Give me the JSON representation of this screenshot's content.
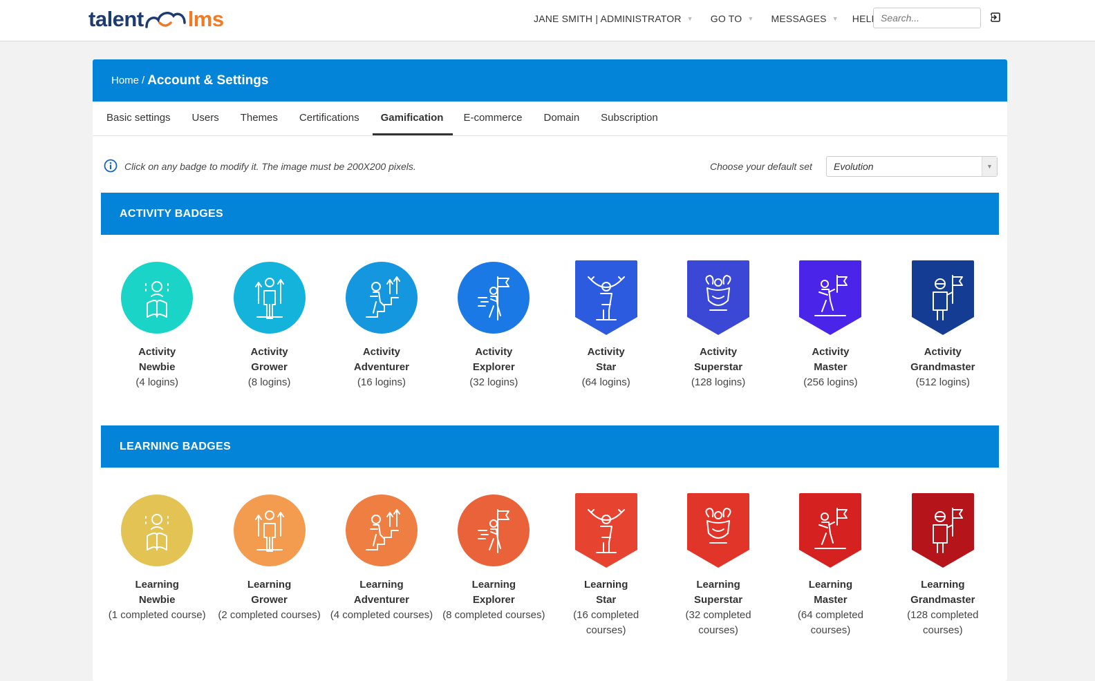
{
  "header": {
    "logo_left": "talent",
    "logo_right": "lms",
    "nav": [
      {
        "label": "JANE SMITH | ADMINISTRATOR"
      },
      {
        "label": "GO TO"
      },
      {
        "label": "MESSAGES"
      },
      {
        "label": "HELP"
      }
    ],
    "search_placeholder": "Search..."
  },
  "breadcrumb": {
    "home": "Home",
    "separator": "/",
    "title": "Account & Settings"
  },
  "tabs": [
    {
      "label": "Basic settings"
    },
    {
      "label": "Users"
    },
    {
      "label": "Themes"
    },
    {
      "label": "Certifications"
    },
    {
      "label": "Gamification",
      "active": true
    },
    {
      "label": "E-commerce"
    },
    {
      "label": "Domain"
    },
    {
      "label": "Subscription"
    }
  ],
  "info": {
    "message": "Click on any badge to modify it. The image must be 200X200 pixels.",
    "choose_label": "Choose your default set",
    "selected_set": "Evolution"
  },
  "activity": {
    "title": "ACTIVITY BADGES",
    "badges": [
      {
        "line1": "Activity",
        "line2": "Newbie",
        "desc": "(4 logins)",
        "color": "#1ad4c8",
        "shape": "circle",
        "icon": "reading-person-icon"
      },
      {
        "line1": "Activity",
        "line2": "Grower",
        "desc": "(8 logins)",
        "color": "#13b3dc",
        "shape": "circle",
        "icon": "growing-person-icon"
      },
      {
        "line1": "Activity",
        "line2": "Adventurer",
        "desc": "(16 logins)",
        "color": "#1597e0",
        "shape": "circle",
        "icon": "climbing-stairs-icon"
      },
      {
        "line1": "Activity",
        "line2": "Explorer",
        "desc": "(32 logins)",
        "color": "#1a79e5",
        "shape": "circle",
        "icon": "flag-walker-icon"
      },
      {
        "line1": "Activity",
        "line2": "Star",
        "desc": "(64 logins)",
        "color": "#2d5bdf",
        "shape": "shield",
        "icon": "raised-arms-icon"
      },
      {
        "line1": "Activity",
        "line2": "Superstar",
        "desc": "(128 logins)",
        "color": "#3b48d6",
        "shape": "shield",
        "icon": "strongman-icon"
      },
      {
        "line1": "Activity",
        "line2": "Master",
        "desc": "(256 logins)",
        "color": "#4a24e8",
        "shape": "shield",
        "icon": "summit-flag-icon"
      },
      {
        "line1": "Activity",
        "line2": "Grandmaster",
        "desc": "(512 logins)",
        "color": "#143c93",
        "shape": "shield",
        "icon": "astronaut-flag-icon"
      }
    ]
  },
  "learning": {
    "title": "LEARNING BADGES",
    "badges": [
      {
        "line1": "Learning",
        "line2": "Newbie",
        "desc": "(1 completed course)",
        "color": "#e2c354",
        "shape": "circle",
        "icon": "reading-person-icon"
      },
      {
        "line1": "Learning",
        "line2": "Grower",
        "desc": "(2 completed courses)",
        "color": "#f39b4f",
        "shape": "circle",
        "icon": "growing-person-icon"
      },
      {
        "line1": "Learning",
        "line2": "Adventurer",
        "desc": "(4 completed courses)",
        "color": "#ee7e41",
        "shape": "circle",
        "icon": "climbing-stairs-icon"
      },
      {
        "line1": "Learning",
        "line2": "Explorer",
        "desc": "(8 completed courses)",
        "color": "#e9623a",
        "shape": "circle",
        "icon": "flag-walker-icon"
      },
      {
        "line1": "Learning",
        "line2": "Star",
        "desc": "(16 completed courses)",
        "color": "#e64431",
        "shape": "shield",
        "icon": "raised-arms-icon"
      },
      {
        "line1": "Learning",
        "line2": "Superstar",
        "desc": "(32 completed courses)",
        "color": "#e2352a",
        "shape": "shield",
        "icon": "strongman-icon"
      },
      {
        "line1": "Learning",
        "line2": "Master",
        "desc": "(64 completed courses)",
        "color": "#d52221",
        "shape": "shield",
        "icon": "summit-flag-icon"
      },
      {
        "line1": "Learning",
        "line2": "Grandmaster",
        "desc": "(128 completed courses)",
        "color": "#b5151a",
        "shape": "shield",
        "icon": "astronaut-flag-icon"
      }
    ]
  },
  "colors": {
    "primary": "#0484d8",
    "logo_dark": "#1e3a72",
    "logo_orange": "#f07b24"
  }
}
